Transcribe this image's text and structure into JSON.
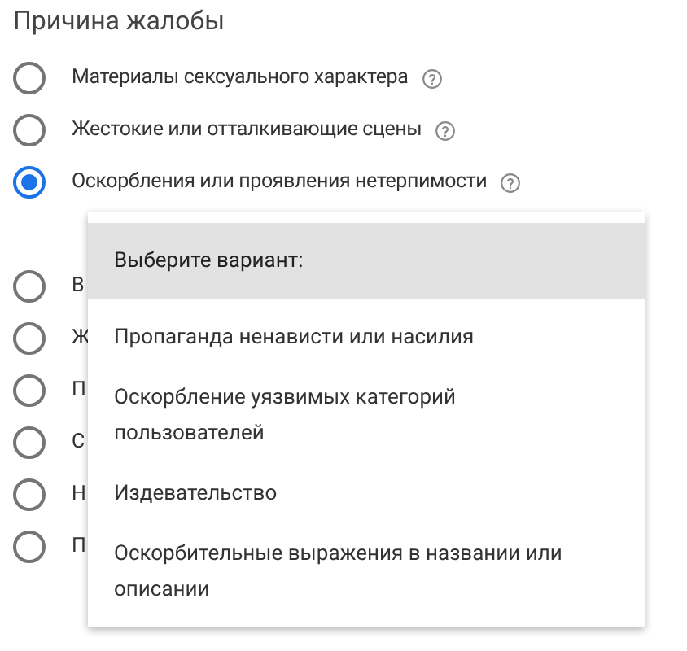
{
  "title": "Причина жалобы",
  "options": [
    {
      "label": "Материалы сексуального характера",
      "help": true,
      "selected": false
    },
    {
      "label": "Жестокие или отталкивающие сцены",
      "help": true,
      "selected": false
    },
    {
      "label": "Оскорбления или проявления нетерпимости",
      "help": true,
      "selected": true
    },
    {
      "label": "В",
      "help": false,
      "selected": false
    },
    {
      "label": "Ж",
      "help": false,
      "selected": false
    },
    {
      "label": "П",
      "help": false,
      "selected": false
    },
    {
      "label": "С",
      "help": false,
      "selected": false
    },
    {
      "label": "Н",
      "help": false,
      "selected": false
    },
    {
      "label": "П",
      "help": false,
      "selected": false
    }
  ],
  "menu": {
    "header": "Выберите вариант:",
    "items": [
      "Пропаганда ненависти или насилия",
      "Оскорбление уязвимых категорий пользователей",
      "Издевательство",
      "Оскорбительные выражения в названии или описании"
    ]
  }
}
